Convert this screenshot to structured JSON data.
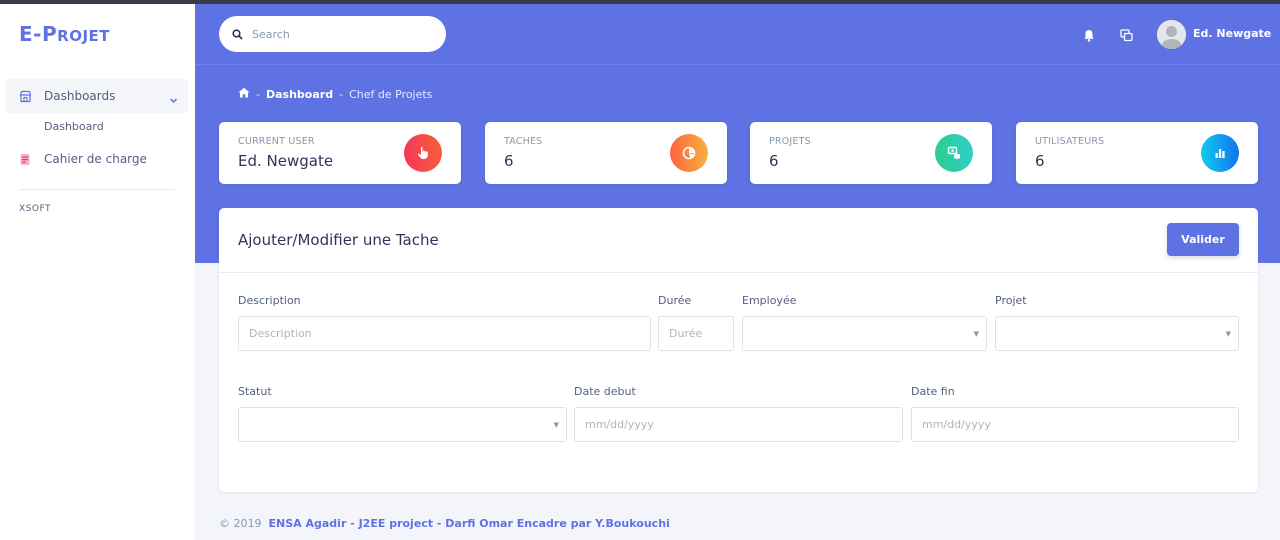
{
  "app": {
    "brand_big_e": "E",
    "brand_dash": "-",
    "brand_big_p": "P",
    "brand_rest": "ROJET"
  },
  "colors": {
    "primary": "#5e72e4",
    "card_icon_user": "#f5365c",
    "card_icon_taches": "#fb6340",
    "card_icon_projets": "#2dce89",
    "card_icon_utilisateurs": "#11cdef"
  },
  "sidebar": {
    "items": [
      {
        "label": "Dashboards",
        "icon": "shop-icon",
        "expanded": true
      },
      {
        "label": "Cahier de charge",
        "icon": "document-icon"
      }
    ],
    "sub_items": [
      "Dashboard"
    ],
    "section_heading": "XSOFT"
  },
  "header": {
    "search_placeholder": "Search",
    "user_name": "Ed. Newgate",
    "icons": [
      "bell-icon",
      "screens-icon",
      "avatar"
    ]
  },
  "breadcrumb": {
    "home_icon": "home-icon",
    "items": [
      "Dashboard",
      "Chef de Projets"
    ]
  },
  "stats": [
    {
      "title": "CURRENT USER",
      "value": "Ed. Newgate",
      "icon": "hand-pointer-icon"
    },
    {
      "title": "TACHES",
      "value": "6",
      "icon": "pie-chart-icon"
    },
    {
      "title": "PROJETS",
      "value": "6",
      "icon": "money-coins-icon"
    },
    {
      "title": "UTILISATEURS",
      "value": "6",
      "icon": "bar-chart-icon"
    }
  ],
  "form": {
    "title": "Ajouter/Modifier une Tache",
    "submit_label": "Valider",
    "fields": {
      "description": {
        "label": "Description",
        "placeholder": "Description"
      },
      "duree": {
        "label": "Durée",
        "placeholder": "Durée"
      },
      "employee": {
        "label": "Employée",
        "value": ""
      },
      "projet": {
        "label": "Projet",
        "value": ""
      },
      "statut": {
        "label": "Statut",
        "value": ""
      },
      "date_debut": {
        "label": "Date debut",
        "placeholder": "mm/dd/yyyy"
      },
      "date_fin": {
        "label": "Date fin",
        "placeholder": "mm/dd/yyyy"
      }
    }
  },
  "footer": {
    "copyright": "© 2019",
    "credit": "ENSA Agadir - J2EE project - Darfi Omar Encadre par Y.Boukouchi"
  }
}
